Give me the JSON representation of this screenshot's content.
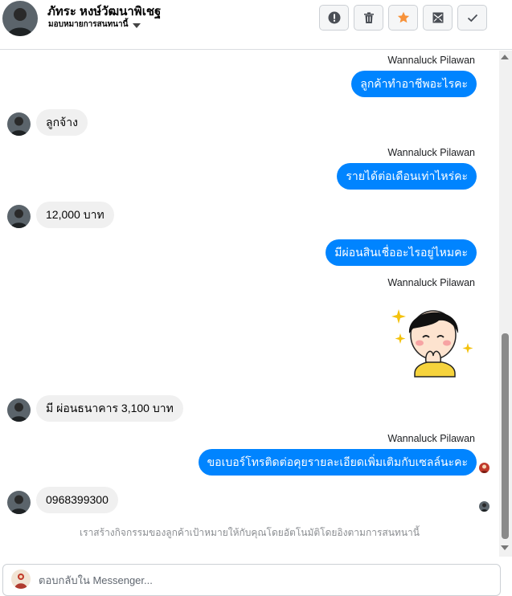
{
  "header": {
    "contact_name": "ภัทระ หงษ์วัฒนาพิเชฐ",
    "assign_label": "มอบหมายการสนทนานี้",
    "buttons": [
      {
        "name": "mark-spam-button",
        "icon": "exclamation-icon"
      },
      {
        "name": "delete-button",
        "icon": "trash-icon"
      },
      {
        "name": "star-button",
        "icon": "star-icon",
        "color": "#f7923a"
      },
      {
        "name": "mark-unread-button",
        "icon": "envelope-icon"
      },
      {
        "name": "mark-done-button",
        "icon": "check-icon"
      }
    ]
  },
  "thread": {
    "messages": [
      {
        "dir": "out",
        "sender": "Wannaluck Pilawan",
        "text": "ลูกค้าทำอาชีพอะไรคะ"
      },
      {
        "dir": "in",
        "text": "ลูกจ้าง"
      },
      {
        "dir": "out",
        "sender": "Wannaluck Pilawan",
        "text": "รายได้ต่อเดือนเท่าไหร่คะ"
      },
      {
        "dir": "in",
        "text": "12,000 บาท"
      },
      {
        "dir": "out",
        "text": "มีผ่อนสินเชื่ออะไรอยู่ไหมคะ"
      },
      {
        "dir": "out",
        "sender": "Wannaluck Pilawan",
        "sticker": "girl-praying-sticker"
      },
      {
        "dir": "in",
        "text": "มี ผ่อนธนาคาร 3,100 บาท"
      },
      {
        "dir": "out",
        "sender": "Wannaluck Pilawan",
        "text": "ขอเบอร์โทรติดต่อคุยรายละเอียดเพิ่มเติมกับเซลล์นะคะ"
      },
      {
        "dir": "in",
        "text": "0968399300"
      }
    ],
    "notice": "เราสร้างกิจกรรมของลูกค้าเป้าหมายให้กับคุณโดยอัตโนมัติโดยอิงตามการสนทนานี้"
  },
  "reply": {
    "placeholder": "ตอบกลับใน Messenger..."
  },
  "colors": {
    "outgoing_bubble": "#0084ff",
    "incoming_bubble": "#f0f0f0",
    "star": "#f7923a"
  }
}
